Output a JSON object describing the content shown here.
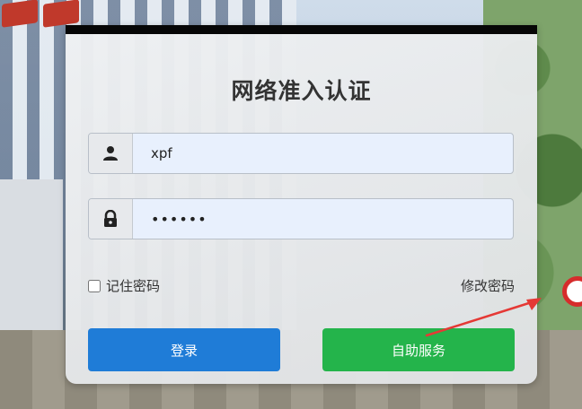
{
  "card": {
    "title": "网络准入认证"
  },
  "form": {
    "username_value": "xpf",
    "password_value": "••••••",
    "remember_label": "记住密码",
    "change_password_label": "修改密码",
    "login_button_label": "登录",
    "self_service_button_label": "自助服务"
  },
  "icons": {
    "username": "user-icon",
    "password": "lock-icon",
    "annotation": "red-arrow"
  },
  "colors": {
    "login_button": "#1f7cd7",
    "self_service_button": "#24b44b",
    "input_background": "#e8f0fd",
    "arrow": "#e53935"
  }
}
